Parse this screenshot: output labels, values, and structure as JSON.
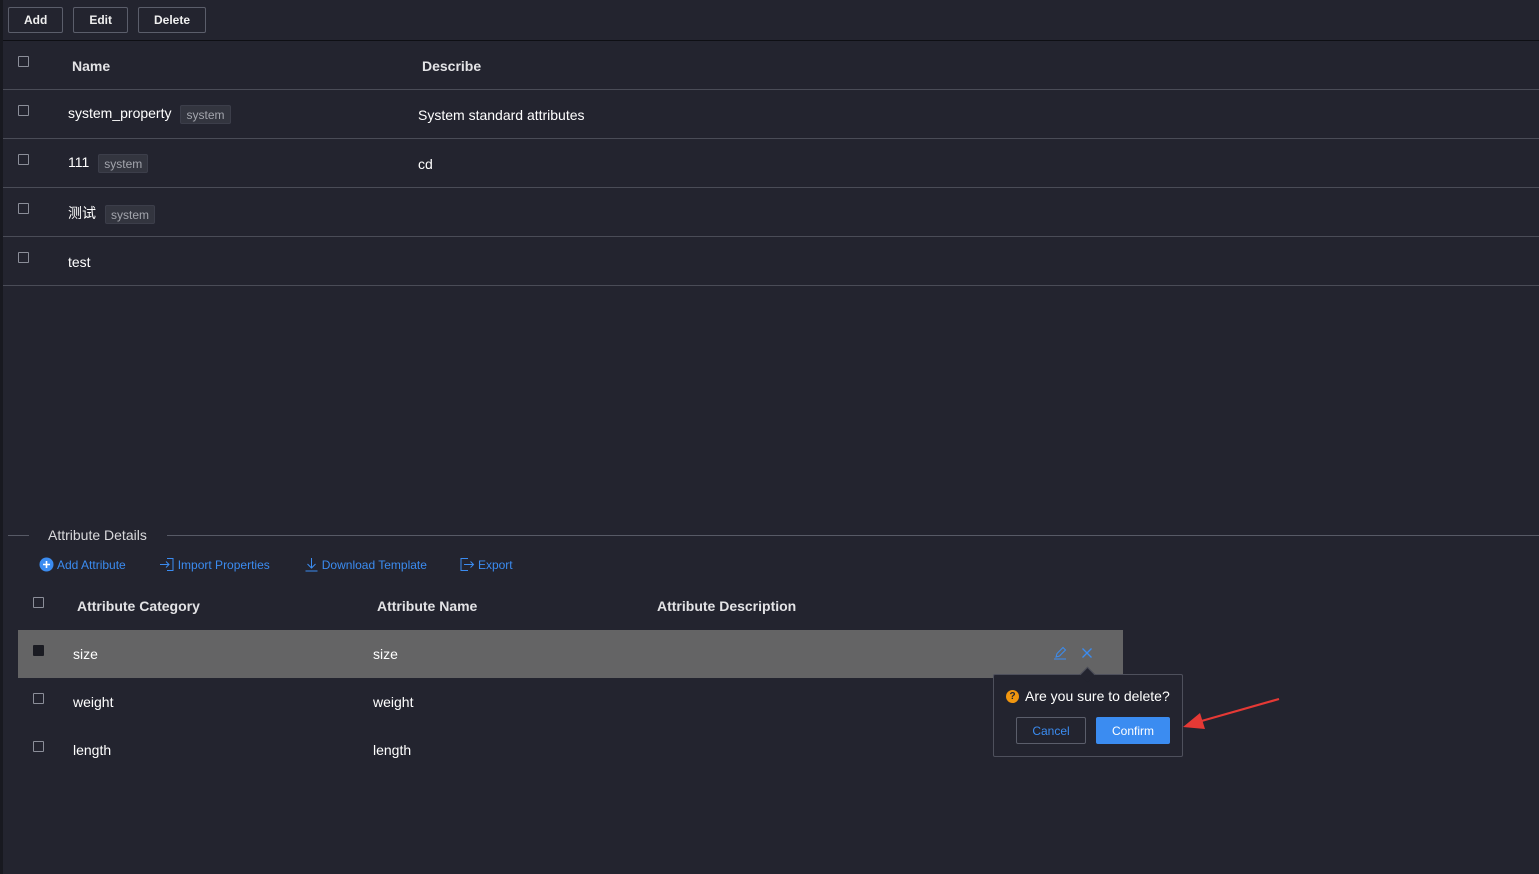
{
  "toolbar": {
    "add_label": "Add",
    "edit_label": "Edit",
    "delete_label": "Delete"
  },
  "top_table": {
    "headers": {
      "name": "Name",
      "describe": "Describe"
    },
    "rows": [
      {
        "name": "system_property",
        "tag": "system",
        "describe": "System standard attributes"
      },
      {
        "name": "111",
        "tag": "system",
        "describe": "cd"
      },
      {
        "name": "测试",
        "tag": "system",
        "describe": ""
      },
      {
        "name": "test",
        "tag": "",
        "describe": ""
      }
    ]
  },
  "details": {
    "title": "Attribute Details",
    "actions": {
      "add": "Add Attribute",
      "import": "Import Properties",
      "download": "Download Template",
      "export": "Export"
    },
    "headers": {
      "category": "Attribute Category",
      "name": "Attribute Name",
      "description": "Attribute Description"
    },
    "rows": [
      {
        "category": "size",
        "name": "size",
        "description": "",
        "selected": true
      },
      {
        "category": "weight",
        "name": "weight",
        "description": ""
      },
      {
        "category": "length",
        "name": "length",
        "description": ""
      }
    ]
  },
  "popconfirm": {
    "question": "Are you sure to delete?",
    "cancel": "Cancel",
    "confirm": "Confirm"
  },
  "icons": {
    "edit": "edit-pencil-icon",
    "delete": "close-x-icon",
    "warning": "question-circle-icon",
    "annotation": "red-arrow"
  },
  "colors": {
    "background": "#23242f",
    "accent": "#3b8cf1",
    "selected_row": "#646465",
    "warning": "#f0960f",
    "annotation": "#e53935"
  }
}
